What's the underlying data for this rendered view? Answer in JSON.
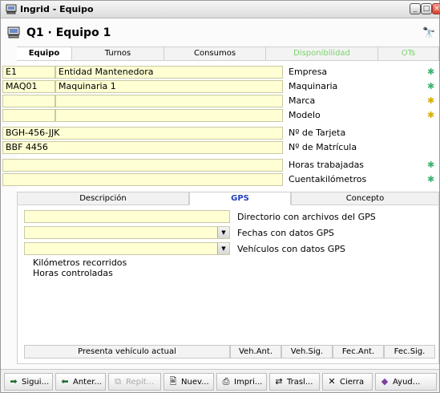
{
  "window": {
    "title": "Ingrid - Equipo"
  },
  "header": {
    "title": "Q1 · Equipo 1"
  },
  "tabs": [
    {
      "label": "Equipo"
    },
    {
      "label": "Turnos"
    },
    {
      "label": "Consumos"
    },
    {
      "label": "Disponibilidad"
    },
    {
      "label": "OTs"
    }
  ],
  "form": {
    "empresa": {
      "code": "E1",
      "name": "Entidad Mantenedora",
      "label": "Empresa"
    },
    "maquinaria": {
      "code": "MAQ01",
      "name": "Maquinaria 1",
      "label": "Maquinaria"
    },
    "marca": {
      "code": "",
      "name": "",
      "label": "Marca"
    },
    "modelo": {
      "code": "",
      "name": "",
      "label": "Modelo"
    },
    "tarjeta": {
      "value": "BGH-456-JJK",
      "label": "Nº de Tarjeta"
    },
    "matricula": {
      "value": "BBF 4456",
      "label": "Nº de Matrícula"
    },
    "horas": {
      "value": "",
      "label": "Horas trabajadas"
    },
    "km": {
      "value": "",
      "label": "Cuentakilómetros"
    }
  },
  "subtabs": [
    {
      "label": "Descripción"
    },
    {
      "label": "GPS"
    },
    {
      "label": "Concepto"
    }
  ],
  "gps": {
    "directorio_label": "Directorio con archivos del GPS",
    "fechas_label": "Fechas con datos GPS",
    "vehiculos_label": "Vehículos con datos GPS",
    "km_recorridos": "Kilómetros recorridos",
    "horas_controladas": "Horas controladas"
  },
  "bottom": {
    "presenta": "Presenta vehículo actual",
    "veh_ant": "Veh.Ant.",
    "veh_sig": "Veh.Sig.",
    "fec_ant": "Fec.Ant.",
    "fec_sig": "Fec.Sig."
  },
  "toolbar": [
    {
      "label": "Sigui..."
    },
    {
      "label": "Anter..."
    },
    {
      "label": "Repit..."
    },
    {
      "label": "Nuev..."
    },
    {
      "label": "Impri..."
    },
    {
      "label": "Trasl..."
    },
    {
      "label": "Cierra"
    },
    {
      "label": "Ayud..."
    }
  ],
  "colors": {
    "field_bg": "#ffffd3",
    "green_star": "#3cb371",
    "yellow_star": "#d4b000",
    "tab_green": "#7bd36b"
  }
}
